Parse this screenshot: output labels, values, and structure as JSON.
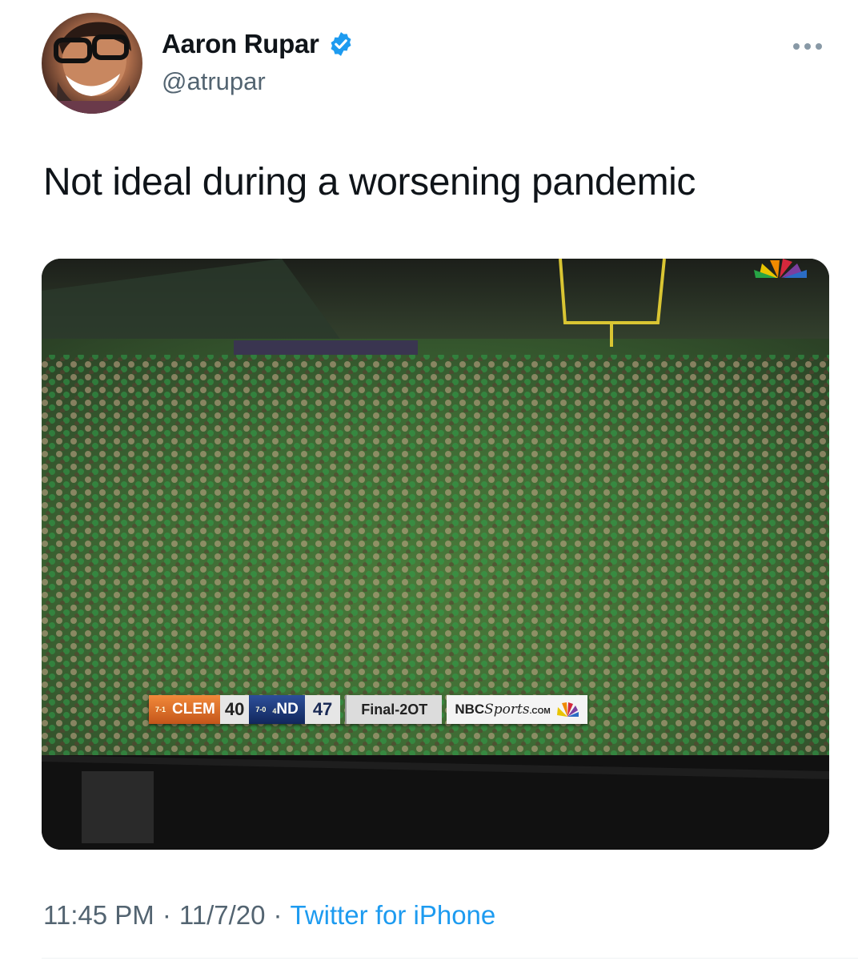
{
  "tweet": {
    "display_name": "Aaron Rupar",
    "handle": "@atrupar",
    "text": "Not ideal during a worsening pandemic",
    "time": "11:45 PM",
    "date": "11/7/20",
    "source": "Twitter for iPhone",
    "separator": "·"
  },
  "scorebug": {
    "team1": "CLEM",
    "team1_record": "7-1",
    "team1_score": "40",
    "team2": "ND",
    "team2_rank": "4",
    "team2_record": "7-0",
    "team2_score": "47",
    "status": "Final-2OT",
    "network": "NBC",
    "network_sub": "Sports",
    "network_suffix": ".COM"
  },
  "colors": {
    "accent": "#1d9bf0",
    "muted": "#536471",
    "text": "#0f1419"
  },
  "icons": {
    "verified": "verified-badge-icon",
    "more": "more-options-icon",
    "nbc_logo": "nbc-peacock-icon"
  }
}
